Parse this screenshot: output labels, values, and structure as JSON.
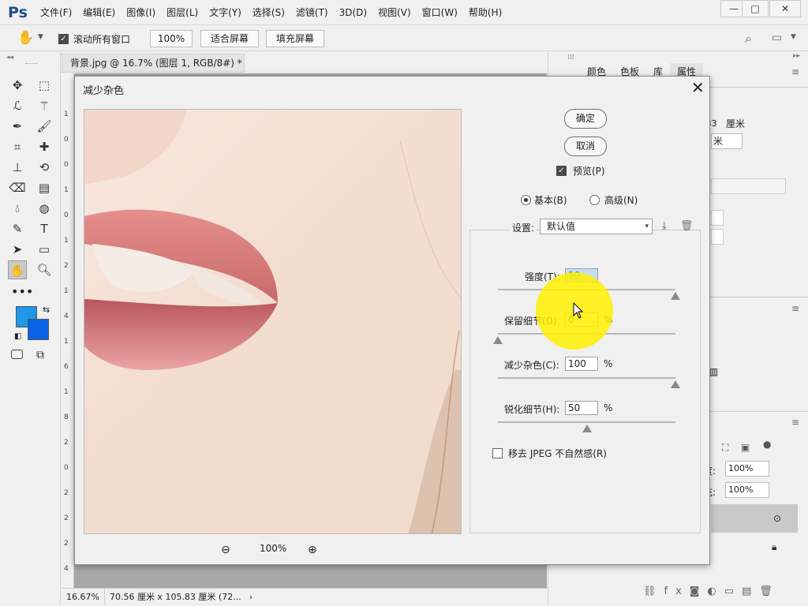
{
  "app": {
    "logo": "Ps"
  },
  "menu": [
    "文件(F)",
    "编辑(E)",
    "图像(I)",
    "图层(L)",
    "文字(Y)",
    "选择(S)",
    "滤镜(T)",
    "3D(D)",
    "视图(V)",
    "窗口(W)",
    "帮助(H)"
  ],
  "window_controls": {
    "minimize": "—",
    "restore": "□",
    "close": "✕"
  },
  "options": {
    "scroll_all_label": "滚动所有窗口",
    "scroll_all_checked": true,
    "zoom_value": "100%",
    "fit_screen": "适合屏幕",
    "fill_screen": "填充屏幕"
  },
  "tools": [
    "move-icon",
    "marquee-icon",
    "lasso-icon",
    "magic-wand-icon",
    "eyedropper-icon",
    "brush-icon",
    "crop-icon",
    "spot-healing-icon",
    "clone-stamp-icon",
    "history-brush-icon",
    "eraser-icon",
    "gradient-icon",
    "blur-icon",
    "sponge-icon",
    "pen-icon",
    "type-icon",
    "path-select-icon",
    "rectangle-icon",
    "hand-icon",
    "zoom-icon"
  ],
  "colors": {
    "foreground": "#1e98e8",
    "background": "#0a62e6",
    "accent": "#1e4e8c"
  },
  "document": {
    "tab_title": "背景.jpg @ 16.7% (图层 1, RGB/8#) *",
    "close": "×"
  },
  "ruler_marks": [
    "1",
    "0",
    "0",
    "1",
    "0",
    "1",
    "2",
    "1",
    "4",
    "1",
    "6",
    "1",
    "8",
    "2",
    "0",
    "2",
    "2",
    "2",
    "4"
  ],
  "status": {
    "zoom": "16.67%",
    "dimensions": "70.56 厘米 x 105.83 厘米 (72...",
    "arrow": "›"
  },
  "right_panel": {
    "tabs": [
      "颜色",
      "色板",
      "库",
      "属性"
    ],
    "frags": {
      "size_value": ".83",
      "unit1": "厘米",
      "unit2": "米",
      "opacity_label": "度:",
      "opacity_value": "100%",
      "fill_label": "充:",
      "fill_value": "100%"
    }
  },
  "dialog": {
    "title": "减少杂色",
    "ok": "确定",
    "cancel": "取消",
    "preview_label": "预览(P)",
    "preview_checked": true,
    "mode_basic": "基本(B)",
    "mode_advanced": "高级(N)",
    "mode_selected": "basic",
    "settings_label": "设置:",
    "settings_value": "默认值",
    "strength": {
      "label": "强度(T):",
      "value": "10",
      "slider": 1.0
    },
    "preserve": {
      "label": "保留细节(D):",
      "value": "0",
      "unit": "%",
      "slider": 0.0
    },
    "reduce_color": {
      "label": "减少杂色(C):",
      "value": "100",
      "unit": "%",
      "slider": 1.0
    },
    "sharpen": {
      "label": "锐化细节(H):",
      "value": "50",
      "unit": "%",
      "slider": 0.5
    },
    "jpeg_label": "移去 JPEG 不自然感(R)",
    "jpeg_checked": false,
    "zoom_value": "100%"
  }
}
